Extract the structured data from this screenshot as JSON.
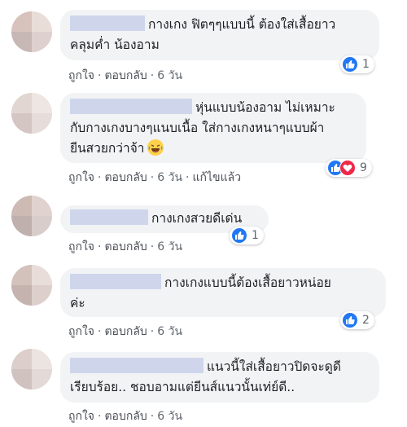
{
  "comments": [
    {
      "lines": [
        "กางเกง ฟิตๆๆแบบนี้ ต้องใส่เสื้อยาว",
        "คลุมค่ำ น้องอาม"
      ],
      "actions": {
        "like": "ถูกใจ",
        "reply": "ตอบกลับ",
        "time": "6 วัน",
        "edited": ""
      },
      "reaction_count": "1"
    },
    {
      "lines": [
        "หุ่นแบบน้องอาม ไม่เหมาะ",
        "กับกางเกงบางๆแนบเนื้อ ใส่กางเกงหนาๆแบบผ้า",
        "ยีนสวยกว่าจ้า"
      ],
      "actions": {
        "like": "ถูกใจ",
        "reply": "ตอบกลับ",
        "time": "6 วัน",
        "edited": "แก้ไขแล้ว"
      },
      "reaction_count": "9"
    },
    {
      "lines": [
        "กางเกงสวยดีเด่น"
      ],
      "actions": {
        "like": "ถูกใจ",
        "reply": "ตอบกลับ",
        "time": "6 วัน",
        "edited": ""
      },
      "reaction_count": "1"
    },
    {
      "lines": [
        "กางเกงแบบนี้ต้องเสื้อยาวหน่อย",
        "ค่ะ"
      ],
      "actions": {
        "like": "ถูกใจ",
        "reply": "ตอบกลับ",
        "time": "6 วัน",
        "edited": ""
      },
      "reaction_count": "2"
    },
    {
      "lines": [
        "แนวนี้ใส่เสื้อยาวปิดจะดูดี",
        "เรียบร้อย.. ชอบอามแต่ยีนส์แนวนั้นเท่ย์ดี.."
      ],
      "actions": {
        "like": "ถูกใจ",
        "reply": "ตอบกลับ",
        "time": "6 วัน",
        "edited": ""
      },
      "reaction_count": ""
    }
  ],
  "separator": "·",
  "colors": {
    "like": "#2078f4",
    "love": "#f0284a",
    "bubble": "#f2f3f5",
    "blurred_name": "#cfd6ec"
  },
  "icons": {
    "like": "thumbs-up-icon",
    "love": "heart-icon",
    "emoji": "laughing-emoji-icon"
  }
}
